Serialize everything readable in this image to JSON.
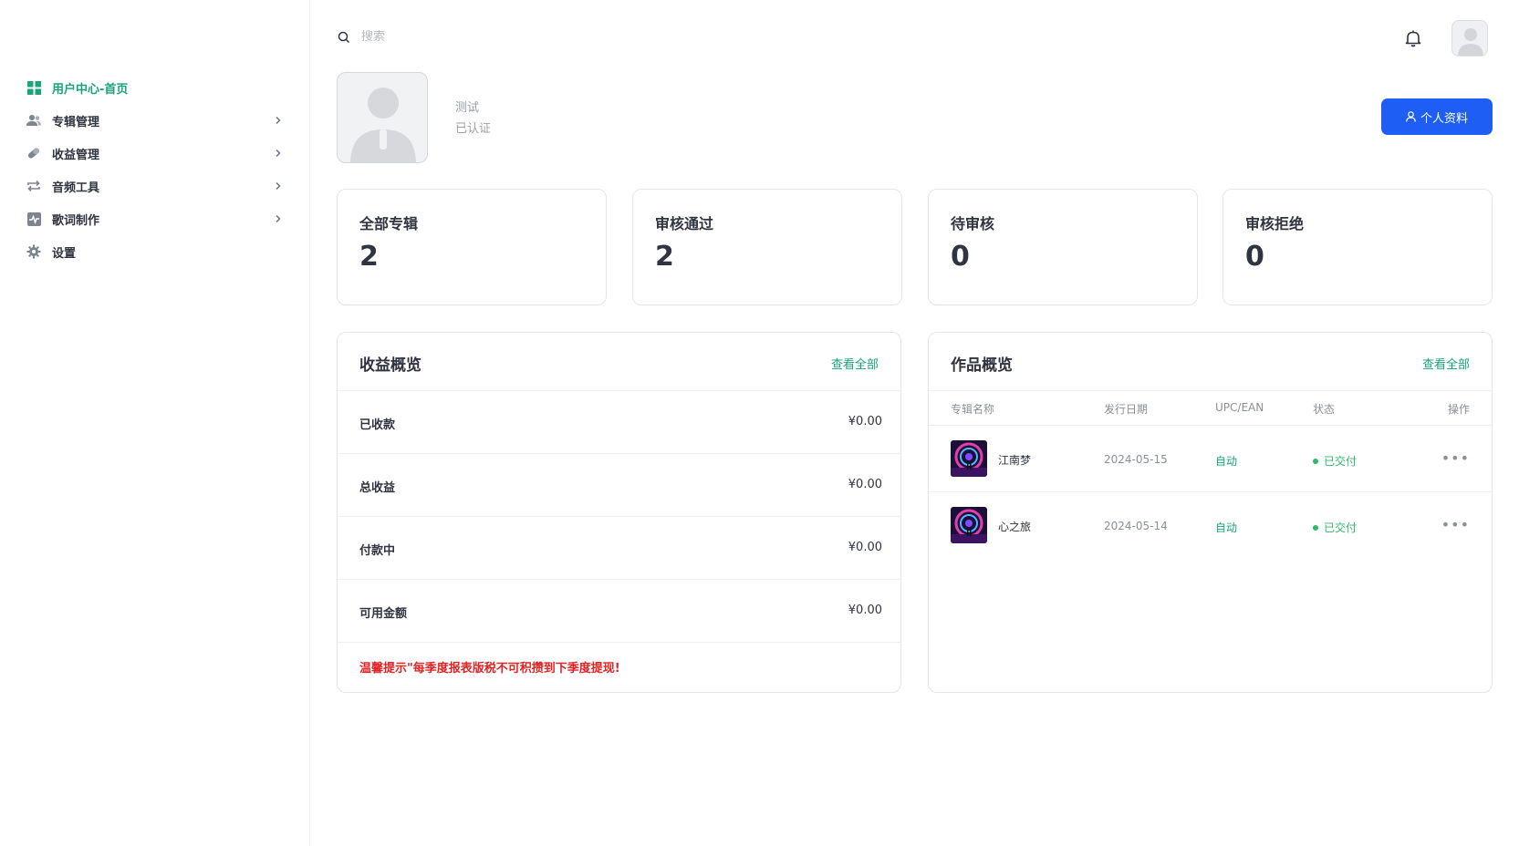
{
  "sidebar": {
    "items": [
      {
        "label": "用户中心-首页",
        "icon": "dashboard-grid-icon",
        "active": true,
        "has_children": false
      },
      {
        "label": "专辑管理",
        "icon": "users-icon",
        "active": false,
        "has_children": true
      },
      {
        "label": "收益管理",
        "icon": "pill-icon",
        "active": false,
        "has_children": true
      },
      {
        "label": "音频工具",
        "icon": "repeat-arrows-icon",
        "active": false,
        "has_children": true
      },
      {
        "label": "歌词制作",
        "icon": "pulse-icon",
        "active": false,
        "has_children": true
      },
      {
        "label": "设置",
        "icon": "gear-icon",
        "active": false,
        "has_children": false
      }
    ]
  },
  "topbar": {
    "search_placeholder": "搜索"
  },
  "profile": {
    "name": "测试",
    "status": "已认证",
    "button_label": "个人资料"
  },
  "stats": [
    {
      "title": "全部专辑",
      "value": "2"
    },
    {
      "title": "审核通过",
      "value": "2"
    },
    {
      "title": "待审核",
      "value": "0"
    },
    {
      "title": "审核拒绝",
      "value": "0"
    }
  ],
  "income": {
    "title": "收益概览",
    "view_all": "查看全部",
    "rows": [
      {
        "label": "已收款",
        "value": "¥0.00"
      },
      {
        "label": "总收益",
        "value": "¥0.00"
      },
      {
        "label": "付款中",
        "value": "¥0.00"
      },
      {
        "label": "可用金额",
        "value": "¥0.00"
      }
    ],
    "tip": "温馨提示\"每季度报表版税不可积攒到下季度提现!"
  },
  "works": {
    "title": "作品概览",
    "view_all": "查看全部",
    "columns": [
      "专辑名称",
      "发行日期",
      "UPC/EAN",
      "状态",
      "操作"
    ],
    "rows": [
      {
        "name": "江南梦",
        "date": "2024-05-15",
        "upc": "自动",
        "status": "已交付"
      },
      {
        "name": "心之旅",
        "date": "2024-05-14",
        "upc": "自动",
        "status": "已交付"
      }
    ]
  },
  "colors": {
    "accent_green": "#18a37a",
    "primary_blue": "#1f5ef5",
    "warning_red": "#e02424"
  }
}
